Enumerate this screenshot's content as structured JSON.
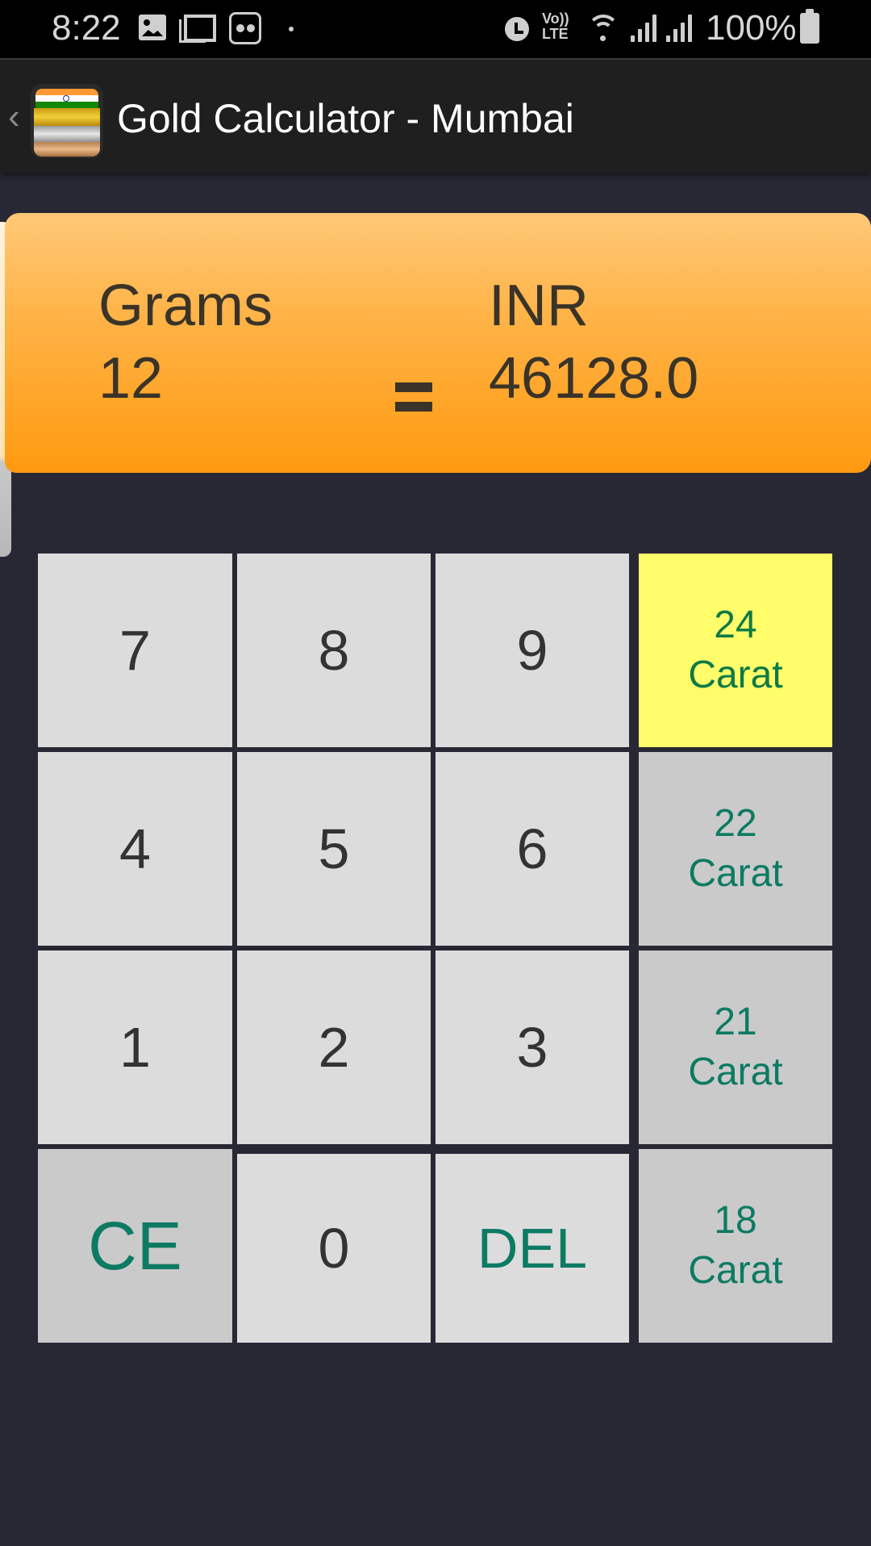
{
  "status_bar": {
    "time": "8:22",
    "left_icons": [
      "gallery-icon",
      "gmail-icon",
      "messenger-icon",
      "dot-icon"
    ],
    "right_icons": [
      "alarm-icon",
      "volte-icon",
      "wifi-icon",
      "signal-icon",
      "signal-icon"
    ],
    "volte_line1": "Vo))",
    "volte_line2": "LTE",
    "battery": "100%"
  },
  "app_bar": {
    "back_icon": "‹",
    "title": "Gold Calculator - Mumbai"
  },
  "display": {
    "input_label": "Grams",
    "input_value": "12",
    "equals": "=",
    "output_label": "INR",
    "output_value": "46128.0"
  },
  "keypad": {
    "digits": [
      {
        "key": "7"
      },
      {
        "key": "8"
      },
      {
        "key": "9"
      },
      {
        "key": "4"
      },
      {
        "key": "5"
      },
      {
        "key": "6"
      },
      {
        "key": "1"
      },
      {
        "key": "2"
      },
      {
        "key": "3"
      }
    ],
    "zero": "0",
    "clear": "CE",
    "delete": "DEL",
    "carats": [
      {
        "number": "24",
        "unit": "Carat",
        "selected": true
      },
      {
        "number": "22",
        "unit": "Carat",
        "selected": false
      },
      {
        "number": "21",
        "unit": "Carat",
        "selected": false
      },
      {
        "number": "18",
        "unit": "Carat",
        "selected": false
      }
    ]
  },
  "colors": {
    "background": "#282835",
    "app_bar": "#1f1f1f",
    "card_top": "#ffc878",
    "card_bottom": "#ff9a10",
    "key": "#dcdcdc",
    "key_alt": "#cacaca",
    "selected_carat": "#fffd6a",
    "accent_text": "#0d7a63"
  }
}
